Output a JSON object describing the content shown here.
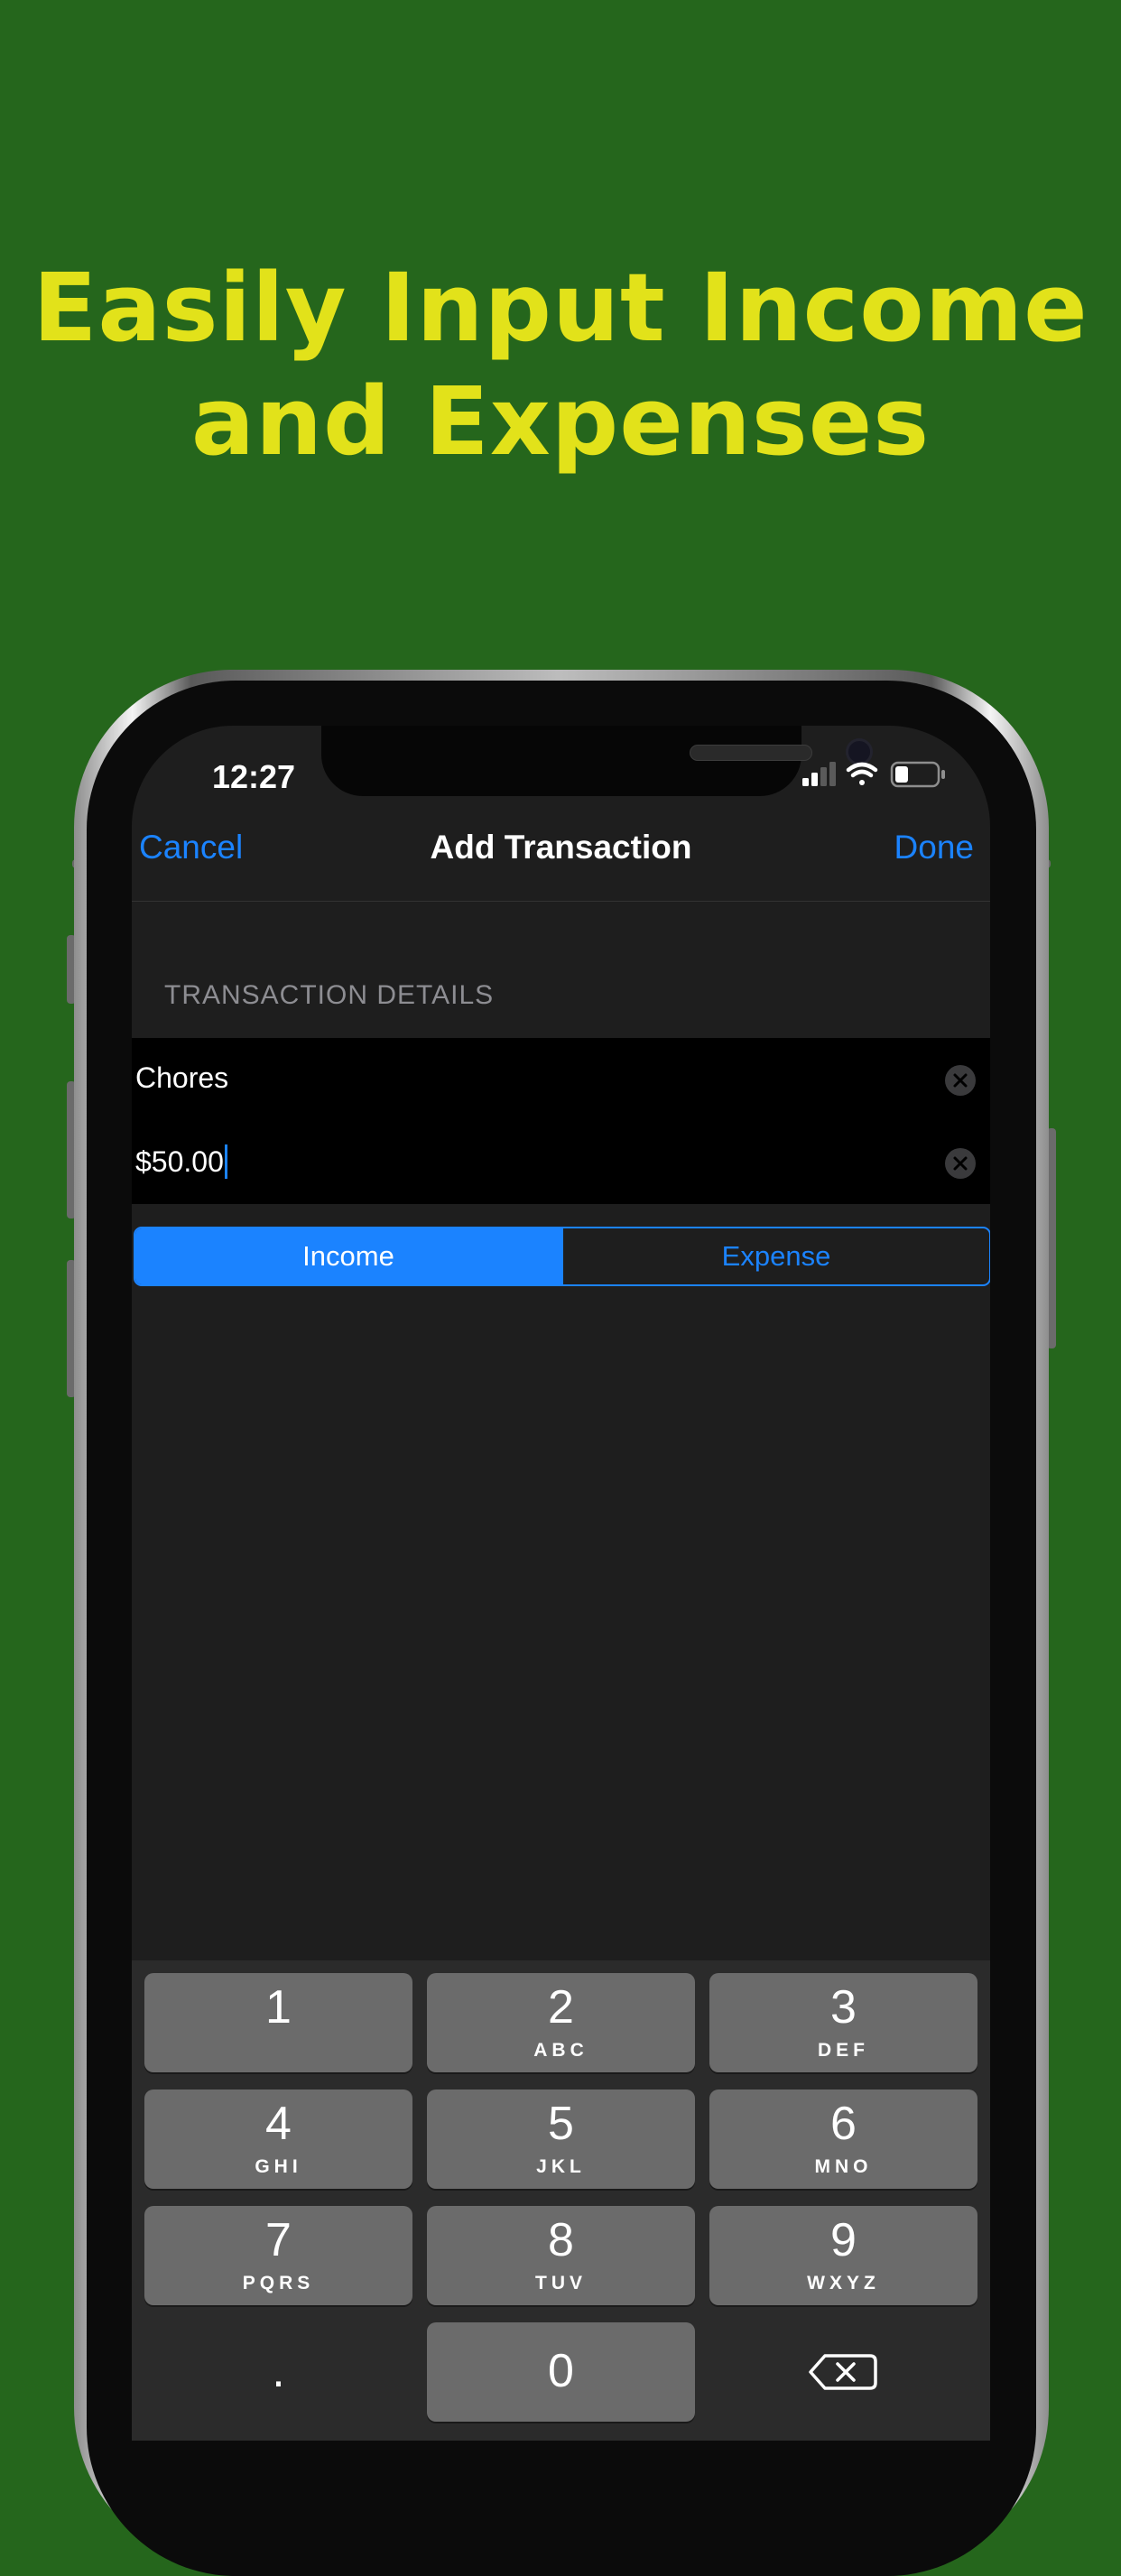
{
  "headline": {
    "line1": "Easily Input Income",
    "line2": "and Expenses"
  },
  "status_bar": {
    "time": "12:27"
  },
  "nav": {
    "cancel": "Cancel",
    "title": "Add Transaction",
    "done": "Done"
  },
  "section_header": "TRANSACTION DETAILS",
  "fields": {
    "description": "Chores",
    "amount": "$50.00"
  },
  "segment": {
    "income": "Income",
    "expense": "Expense",
    "selected": "Income"
  },
  "keypad": {
    "k1": {
      "num": "1",
      "letters": ""
    },
    "k2": {
      "num": "2",
      "letters": "ABC"
    },
    "k3": {
      "num": "3",
      "letters": "DEF"
    },
    "k4": {
      "num": "4",
      "letters": "GHI"
    },
    "k5": {
      "num": "5",
      "letters": "JKL"
    },
    "k6": {
      "num": "6",
      "letters": "MNO"
    },
    "k7": {
      "num": "7",
      "letters": "PQRS"
    },
    "k8": {
      "num": "8",
      "letters": "TUV"
    },
    "k9": {
      "num": "9",
      "letters": "WXYZ"
    },
    "dot": ".",
    "k0": "0"
  },
  "colors": {
    "background": "#25661c",
    "headline": "#e2e21a",
    "accent": "#1b83ff"
  }
}
